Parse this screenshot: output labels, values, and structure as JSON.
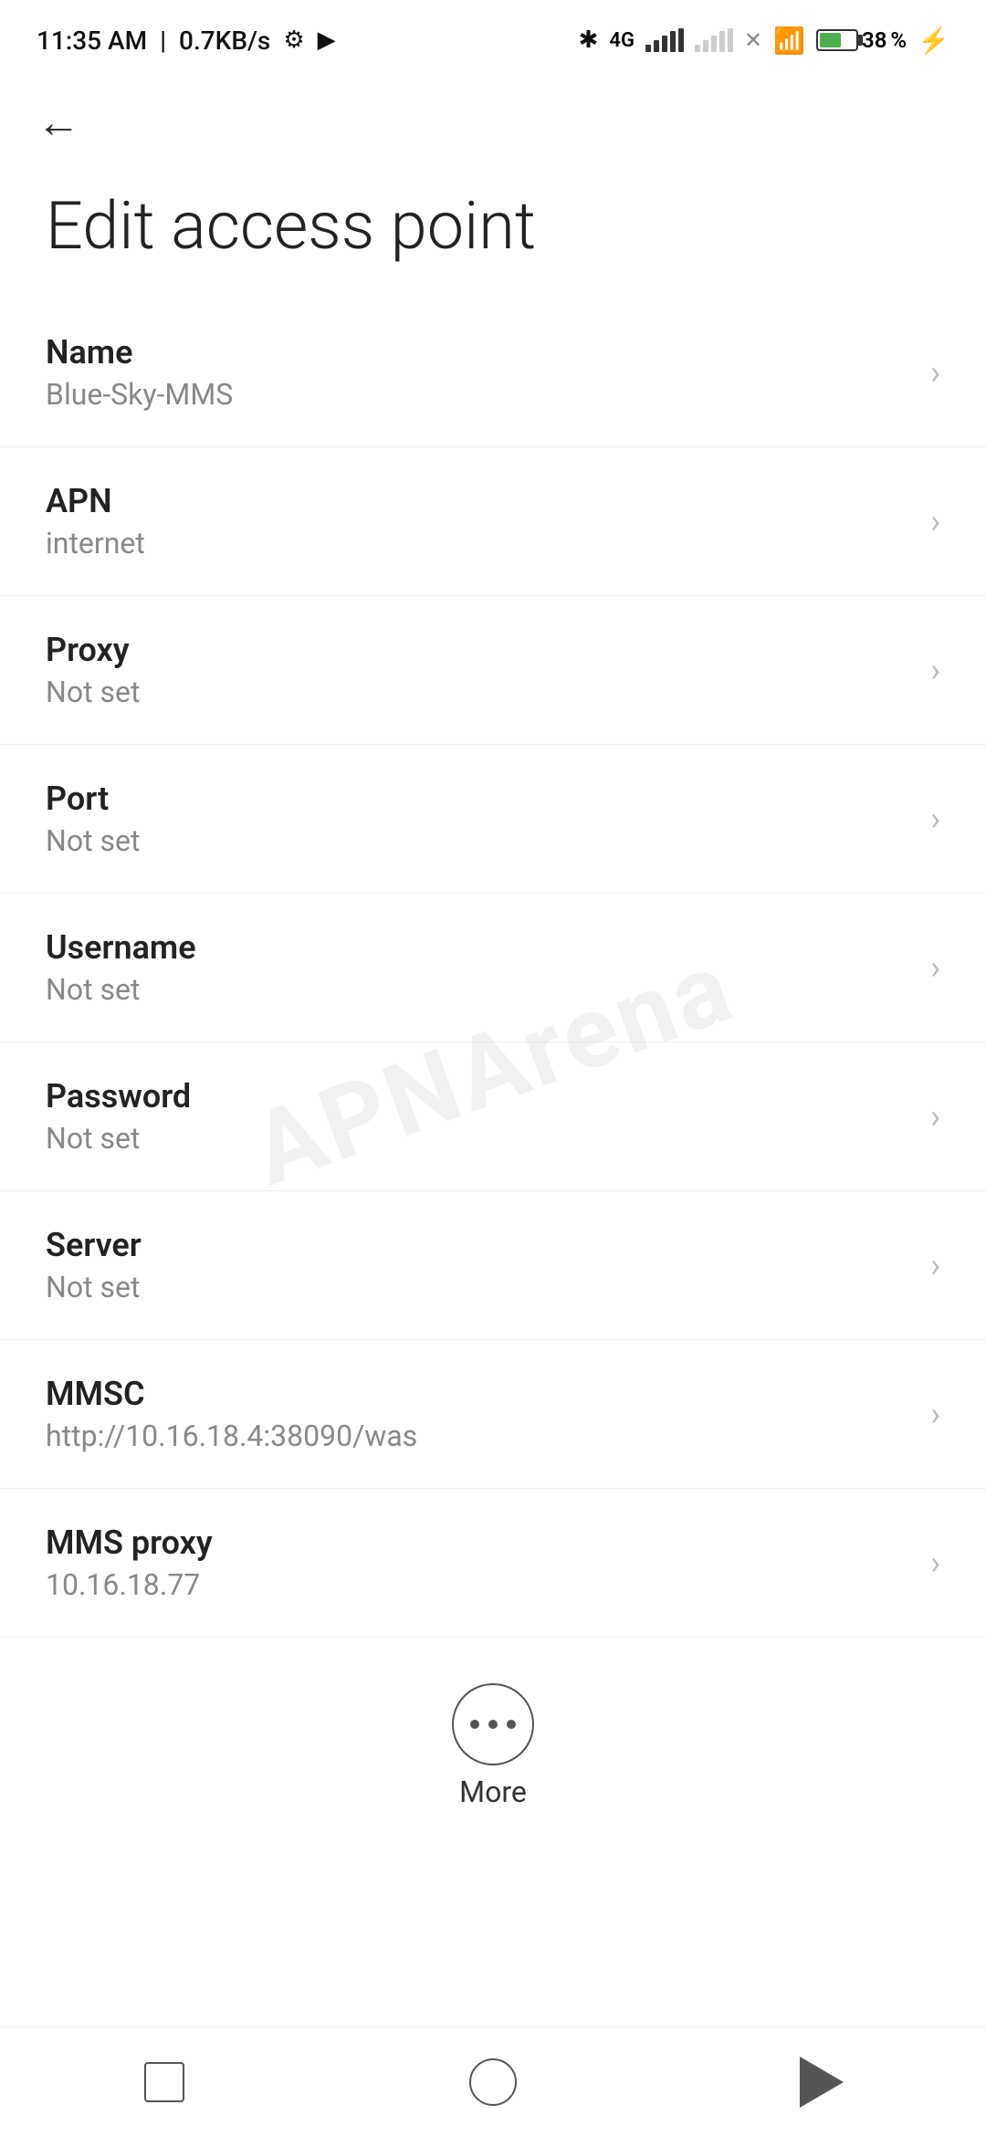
{
  "statusBar": {
    "time": "11:35 AM",
    "speed": "0.7KB/s",
    "batteryPercent": "38"
  },
  "nav": {
    "backLabel": "←"
  },
  "pageTitle": "Edit access point",
  "settings": [
    {
      "label": "Name",
      "value": "Blue-Sky-MMS"
    },
    {
      "label": "APN",
      "value": "internet"
    },
    {
      "label": "Proxy",
      "value": "Not set"
    },
    {
      "label": "Port",
      "value": "Not set"
    },
    {
      "label": "Username",
      "value": "Not set"
    },
    {
      "label": "Password",
      "value": "Not set"
    },
    {
      "label": "Server",
      "value": "Not set"
    },
    {
      "label": "MMSC",
      "value": "http://10.16.18.4:38090/was"
    },
    {
      "label": "MMS proxy",
      "value": "10.16.18.77"
    }
  ],
  "moreButton": {
    "label": "More"
  },
  "watermark": "APNArena",
  "bottomNav": {
    "squareLabel": "recent-apps",
    "circleLabel": "home",
    "triangleLabel": "back"
  }
}
